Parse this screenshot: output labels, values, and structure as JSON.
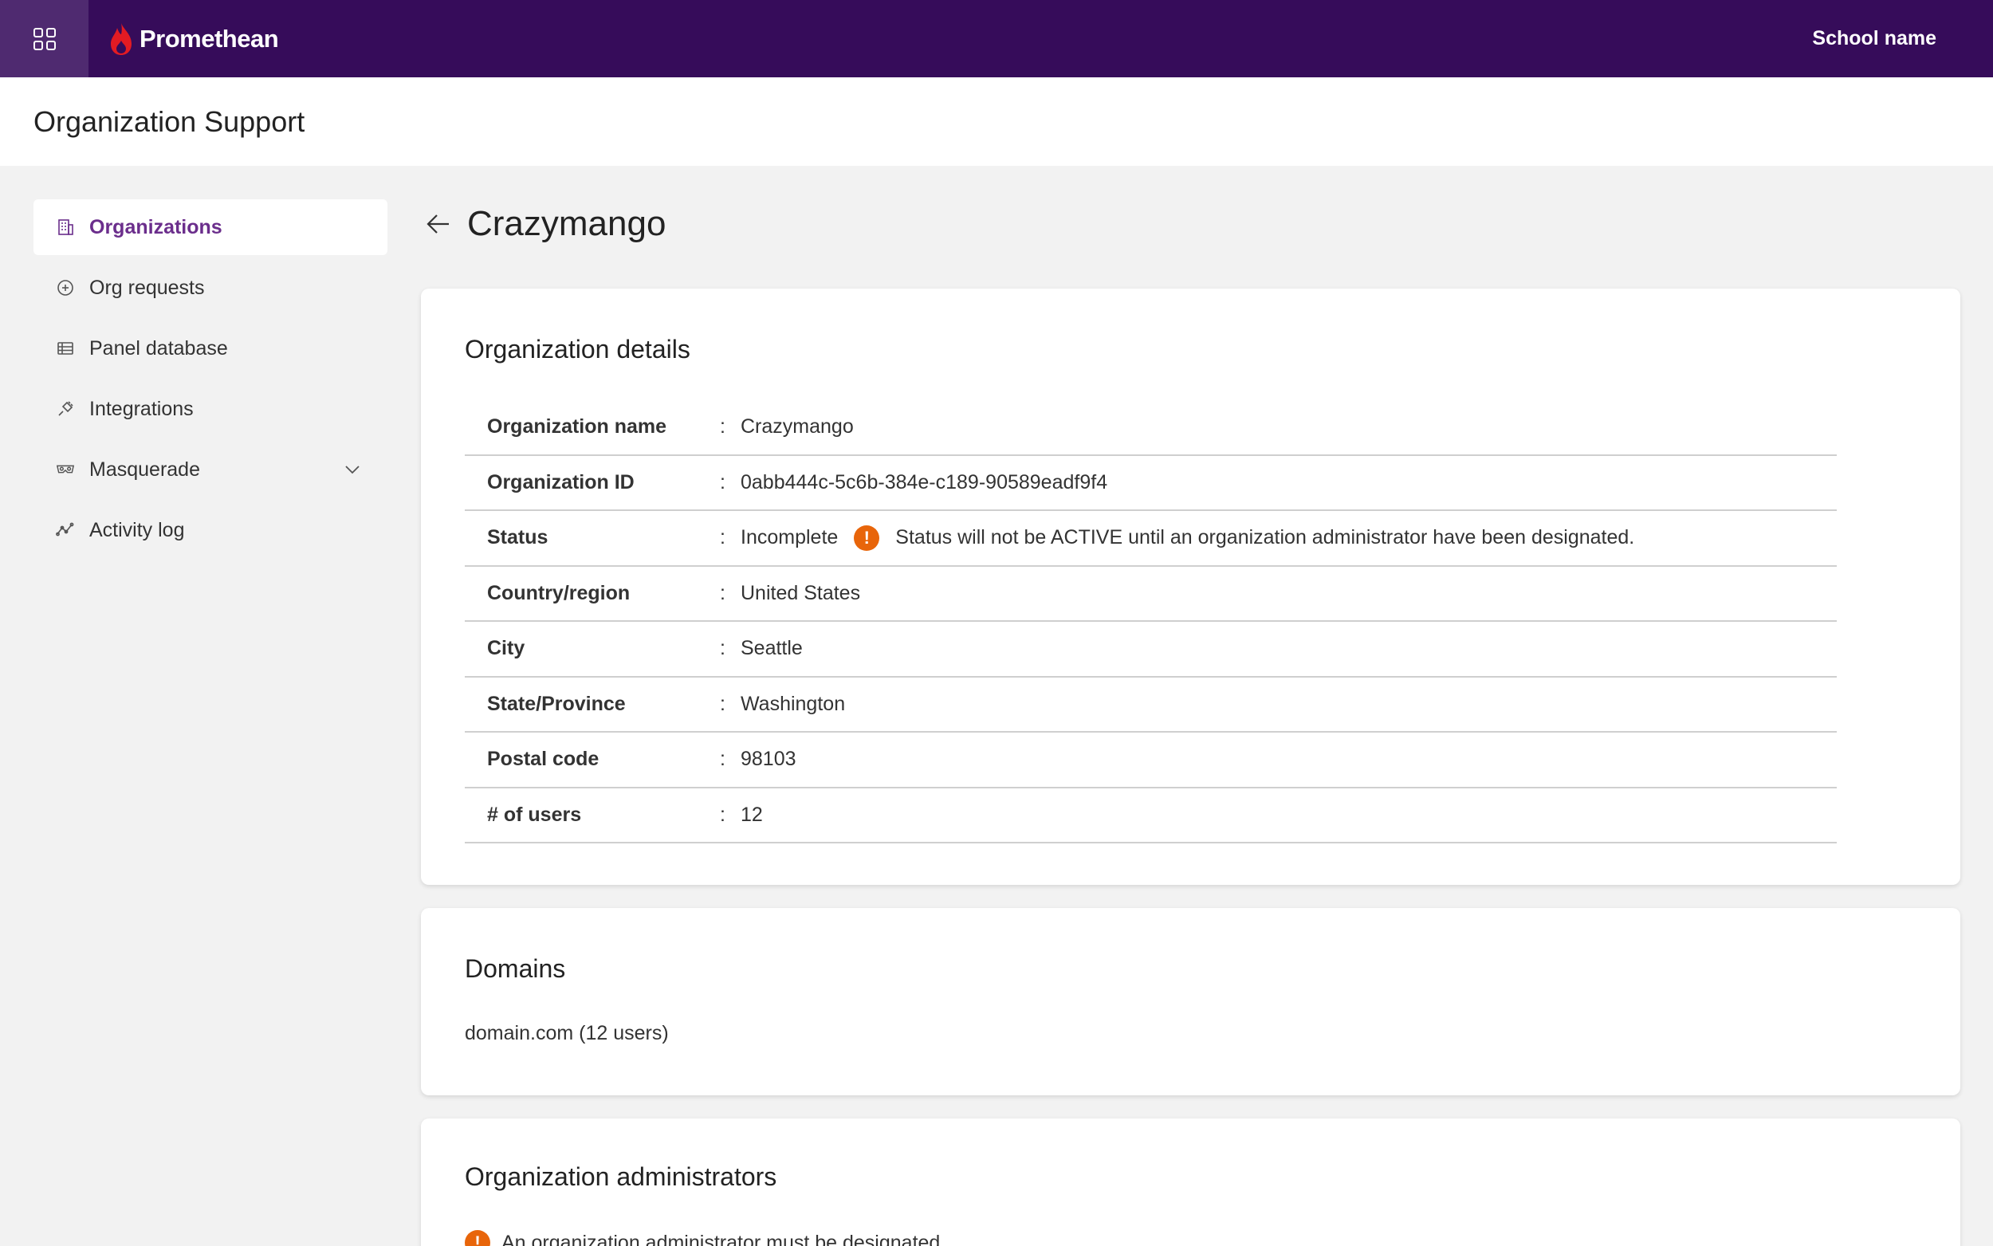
{
  "topbar": {
    "brand_name": "Promethean",
    "school_name": "School name"
  },
  "header": {
    "title": "Organization Support"
  },
  "sidebar": {
    "items": [
      {
        "label": "Organizations",
        "icon": "building-icon",
        "active": true
      },
      {
        "label": "Org requests",
        "icon": "plus-circle-icon"
      },
      {
        "label": "Panel database",
        "icon": "table-icon"
      },
      {
        "label": "Integrations",
        "icon": "plug-icon"
      },
      {
        "label": "Masquerade",
        "icon": "mask-icon",
        "expandable": true
      },
      {
        "label": "Activity log",
        "icon": "activity-icon"
      }
    ]
  },
  "page": {
    "title": "Crazymango"
  },
  "details": {
    "title": "Organization details",
    "rows": [
      {
        "label": "Organization name",
        "value": "Crazymango"
      },
      {
        "label": "Organization ID",
        "value": "0abb444c-5c6b-384e-c189-90589eadf9f4"
      },
      {
        "label": "Status",
        "value": "Incomplete",
        "note": "Status will not be ACTIVE until an organization administrator have been designated."
      },
      {
        "label": "Country/region",
        "value": "United States"
      },
      {
        "label": "City",
        "value": "Seattle"
      },
      {
        "label": "State/Province",
        "value": "Washington"
      },
      {
        "label": "Postal code",
        "value": "98103"
      },
      {
        "label": "# of users",
        "value": "12"
      }
    ],
    "separator": ":"
  },
  "domains": {
    "title": "Domains",
    "text": "domain.com (12 users)"
  },
  "admins": {
    "title": "Organization administrators",
    "warning": "An organization administrator must be designated",
    "warning_glyph": "!"
  },
  "colors": {
    "topbar": "#360c5a",
    "accent": "#6b2e8c",
    "warning": "#e8650a",
    "brand_flame": "#e31b23"
  }
}
